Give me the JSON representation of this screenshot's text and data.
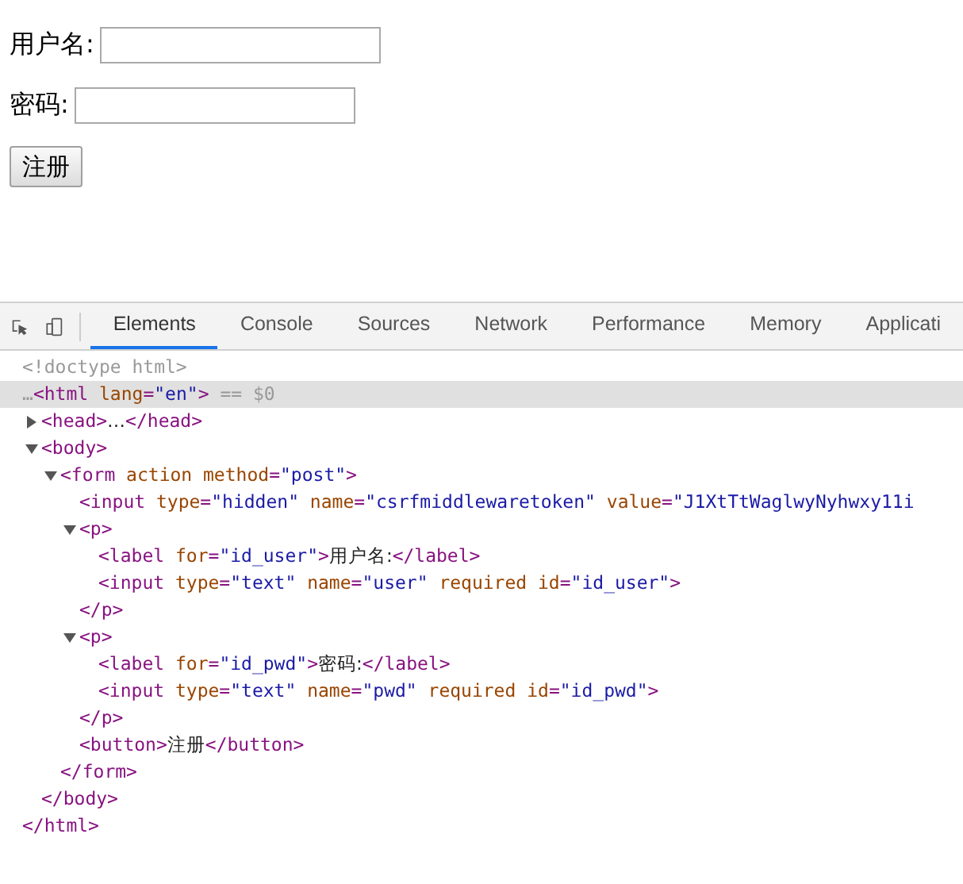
{
  "form": {
    "fields": [
      {
        "label": "用户名:"
      },
      {
        "label": "密码:"
      }
    ],
    "submit": "注册"
  },
  "devtools": {
    "tabs": [
      {
        "label": "Elements",
        "selected": true
      },
      {
        "label": "Console",
        "selected": false
      },
      {
        "label": "Sources",
        "selected": false
      },
      {
        "label": "Network",
        "selected": false
      },
      {
        "label": "Performance",
        "selected": false
      },
      {
        "label": "Memory",
        "selected": false
      },
      {
        "label": "Applicati",
        "selected": false
      }
    ],
    "dom": [
      {
        "tokens": [
          {
            "kind": "muted",
            "text": "<!doctype html>"
          }
        ]
      },
      {
        "selected": true,
        "tokens": [
          {
            "kind": "muted",
            "text": "…"
          },
          {
            "kind": "tag",
            "text": "<html"
          },
          {
            "kind": "attr",
            "text": " lang"
          },
          {
            "kind": "tag",
            "text": "="
          },
          {
            "kind": "value",
            "text": "\"en\""
          },
          {
            "kind": "tag",
            "text": ">"
          },
          {
            "kind": "muted",
            "text": " == $0"
          }
        ],
        "close": [
          {
            "kind": "tag",
            "text": "</html>"
          }
        ],
        "children": [
          {
            "expanded": false,
            "tokens": [
              {
                "kind": "tag",
                "text": "<head>"
              },
              {
                "kind": "text",
                "text": "…"
              },
              {
                "kind": "tag",
                "text": "</head>"
              }
            ]
          },
          {
            "expanded": true,
            "tokens": [
              {
                "kind": "tag",
                "text": "<body>"
              }
            ],
            "close": [
              {
                "kind": "tag",
                "text": "</body>"
              }
            ],
            "children": [
              {
                "expanded": true,
                "tokens": [
                  {
                    "kind": "tag",
                    "text": "<form"
                  },
                  {
                    "kind": "attr",
                    "text": " action method"
                  },
                  {
                    "kind": "tag",
                    "text": "="
                  },
                  {
                    "kind": "value",
                    "text": "\"post\""
                  },
                  {
                    "kind": "tag",
                    "text": ">"
                  }
                ],
                "close": [
                  {
                    "kind": "tag",
                    "text": "</form>"
                  }
                ],
                "children": [
                  {
                    "tokens": [
                      {
                        "kind": "tag",
                        "text": "<input"
                      },
                      {
                        "kind": "attr",
                        "text": " type"
                      },
                      {
                        "kind": "tag",
                        "text": "="
                      },
                      {
                        "kind": "value",
                        "text": "\"hidden\""
                      },
                      {
                        "kind": "attr",
                        "text": " name"
                      },
                      {
                        "kind": "tag",
                        "text": "="
                      },
                      {
                        "kind": "value",
                        "text": "\"csrfmiddlewaretoken\""
                      },
                      {
                        "kind": "attr",
                        "text": " value"
                      },
                      {
                        "kind": "tag",
                        "text": "="
                      },
                      {
                        "kind": "value",
                        "text": "\"J1XtTtWaglwyNyhwxy11i"
                      }
                    ]
                  },
                  {
                    "expanded": true,
                    "tokens": [
                      {
                        "kind": "tag",
                        "text": "<p>"
                      }
                    ],
                    "close": [
                      {
                        "kind": "tag",
                        "text": "</p>"
                      }
                    ],
                    "children": [
                      {
                        "tokens": [
                          {
                            "kind": "tag",
                            "text": "<label"
                          },
                          {
                            "kind": "attr",
                            "text": " for"
                          },
                          {
                            "kind": "tag",
                            "text": "="
                          },
                          {
                            "kind": "value",
                            "text": "\"id_user\""
                          },
                          {
                            "kind": "tag",
                            "text": ">"
                          },
                          {
                            "kind": "text",
                            "text": "用户名:"
                          },
                          {
                            "kind": "tag",
                            "text": "</label>"
                          }
                        ]
                      },
                      {
                        "tokens": [
                          {
                            "kind": "tag",
                            "text": "<input"
                          },
                          {
                            "kind": "attr",
                            "text": " type"
                          },
                          {
                            "kind": "tag",
                            "text": "="
                          },
                          {
                            "kind": "value",
                            "text": "\"text\""
                          },
                          {
                            "kind": "attr",
                            "text": " name"
                          },
                          {
                            "kind": "tag",
                            "text": "="
                          },
                          {
                            "kind": "value",
                            "text": "\"user\""
                          },
                          {
                            "kind": "attr",
                            "text": " required id"
                          },
                          {
                            "kind": "tag",
                            "text": "="
                          },
                          {
                            "kind": "value",
                            "text": "\"id_user\""
                          },
                          {
                            "kind": "tag",
                            "text": ">"
                          }
                        ]
                      }
                    ]
                  },
                  {
                    "expanded": true,
                    "tokens": [
                      {
                        "kind": "tag",
                        "text": "<p>"
                      }
                    ],
                    "close": [
                      {
                        "kind": "tag",
                        "text": "</p>"
                      }
                    ],
                    "children": [
                      {
                        "tokens": [
                          {
                            "kind": "tag",
                            "text": "<label"
                          },
                          {
                            "kind": "attr",
                            "text": " for"
                          },
                          {
                            "kind": "tag",
                            "text": "="
                          },
                          {
                            "kind": "value",
                            "text": "\"id_pwd\""
                          },
                          {
                            "kind": "tag",
                            "text": ">"
                          },
                          {
                            "kind": "text",
                            "text": "密码:"
                          },
                          {
                            "kind": "tag",
                            "text": "</label>"
                          }
                        ]
                      },
                      {
                        "tokens": [
                          {
                            "kind": "tag",
                            "text": "<input"
                          },
                          {
                            "kind": "attr",
                            "text": " type"
                          },
                          {
                            "kind": "tag",
                            "text": "="
                          },
                          {
                            "kind": "value",
                            "text": "\"text\""
                          },
                          {
                            "kind": "attr",
                            "text": " name"
                          },
                          {
                            "kind": "tag",
                            "text": "="
                          },
                          {
                            "kind": "value",
                            "text": "\"pwd\""
                          },
                          {
                            "kind": "attr",
                            "text": " required id"
                          },
                          {
                            "kind": "tag",
                            "text": "="
                          },
                          {
                            "kind": "value",
                            "text": "\"id_pwd\""
                          },
                          {
                            "kind": "tag",
                            "text": ">"
                          }
                        ]
                      }
                    ]
                  },
                  {
                    "tokens": [
                      {
                        "kind": "tag",
                        "text": "<button>"
                      },
                      {
                        "kind": "text",
                        "text": "注册"
                      },
                      {
                        "kind": "tag",
                        "text": "</button>"
                      }
                    ]
                  }
                ]
              }
            ]
          }
        ]
      }
    ]
  }
}
